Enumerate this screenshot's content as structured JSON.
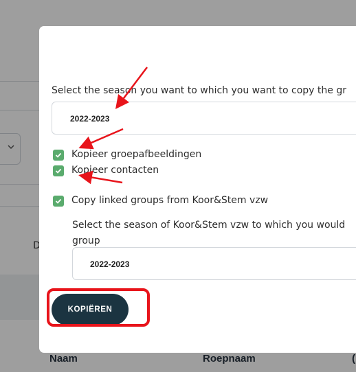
{
  "background": {
    "column_d_partial": "D",
    "table_headers": [
      "Naam",
      "Roepnaam",
      "("
    ],
    "select_chevron_icon": "chevron-down-icon"
  },
  "modal": {
    "season_prompt": "Select the season you want to which you want to copy the gr",
    "season_select_value": "2022-2023",
    "checkboxes": [
      {
        "label": "Kopieer groepafbeeldingen",
        "checked": true
      },
      {
        "label": "Kopieer contacten",
        "checked": true
      },
      {
        "label": "Copy linked groups from Koor&Stem vzw",
        "checked": true
      }
    ],
    "linked_prompt_line1": "Select the season of Koor&Stem vzw to which you would",
    "linked_prompt_line2": "group",
    "linked_season_select_value": "2022-2023",
    "copy_button_label": "KOPIËREN"
  },
  "colors": {
    "checkbox_green": "#5aab6d",
    "button_dark": "#1b3441",
    "annotation_red": "#e8141b"
  }
}
